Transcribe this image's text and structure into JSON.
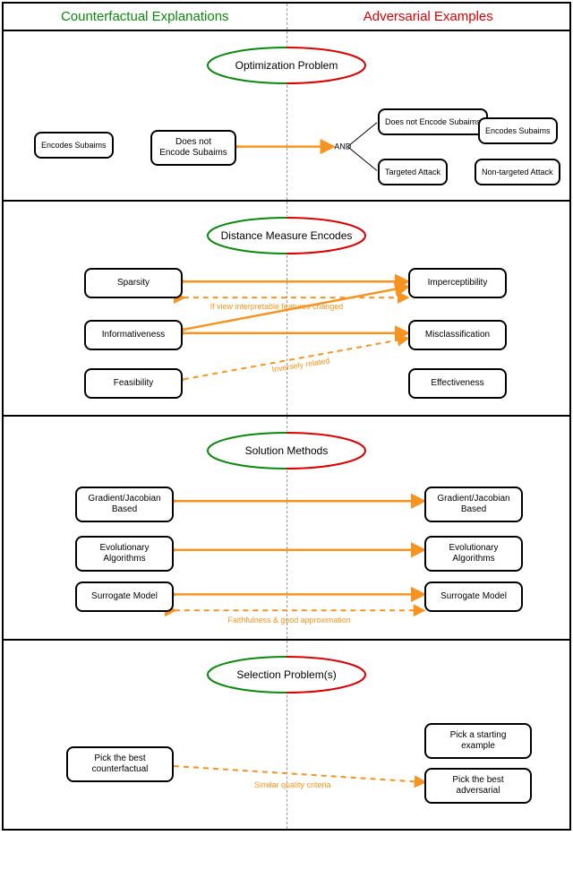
{
  "header": {
    "left": "Counterfactual Explanations",
    "right": "Adversarial Examples"
  },
  "sections": {
    "s1": {
      "title": "Optimization Problem",
      "boxes": {
        "left_enc": "Encodes Subaims",
        "left_noenc": "Does not Encode Subaims",
        "and": "AND",
        "r_noenc": "Does not Encode Subaims",
        "r_targeted": "Targeted Attack",
        "r_enc": "Encodes Subaims",
        "r_nontgt": "Non-targeted Attack"
      }
    },
    "s2": {
      "title": "Distance Measure Encodes",
      "boxes": {
        "sparsity": "Sparsity",
        "imperc": "Imperceptibility",
        "inform": "Informativeness",
        "misclass": "Misclassification",
        "feas": "Feasibility",
        "effect": "Effectiveness"
      },
      "captions": {
        "c1": "If view interpretable features changed",
        "c2": "Inversely related"
      }
    },
    "s3": {
      "title": "Solution Methods",
      "boxes": {
        "gl": "Gradient/Jacobian Based",
        "gr": "Gradient/Jacobian Based",
        "el": "Evolutionary Algorithms",
        "er": "Evolutionary Algorithms",
        "sl": "Surrogate Model",
        "sr": "Surrogate Model"
      },
      "captions": {
        "c1": "Faithfulness & good approximation"
      }
    },
    "s4": {
      "title": "Selection Problem(s)",
      "boxes": {
        "l": "Pick the best counterfactual",
        "r1": "Pick a starting example",
        "r2": "Pick the best adversarial"
      },
      "captions": {
        "c1": "Similar quality criteria"
      }
    }
  }
}
